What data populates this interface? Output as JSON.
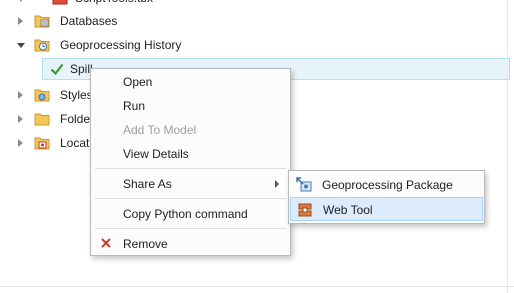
{
  "tree": {
    "items": [
      {
        "label": "ScriptTools.tbx"
      },
      {
        "label": "Databases"
      },
      {
        "label": "Geoprocessing History"
      },
      {
        "label": "Spill"
      },
      {
        "label": "Styles"
      },
      {
        "label": "Folde"
      },
      {
        "label": "Locat"
      }
    ]
  },
  "context_menu": {
    "open": "Open",
    "run": "Run",
    "add_to_model": "Add To Model",
    "view_details": "View Details",
    "share_as": "Share As",
    "copy_python": "Copy Python command",
    "remove": "Remove"
  },
  "submenu": {
    "geoprocessing_package": "Geoprocessing Package",
    "web_tool": "Web Tool"
  },
  "colors": {
    "accent": "#1f7fd0",
    "check": "#3a9a2a",
    "remove": "#d13a2b",
    "selection": "#e6f3fb"
  }
}
